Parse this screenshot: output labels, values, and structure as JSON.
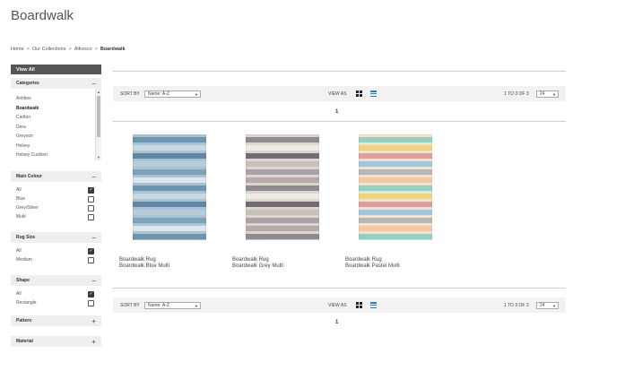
{
  "page": {
    "title": "Boardwalk"
  },
  "breadcrumb": {
    "items": [
      "Home",
      "Our Collections",
      "Alfresco"
    ],
    "current": "Boardwalk",
    "separator": ">"
  },
  "sidebar": {
    "view_all": "View All",
    "categories": {
      "title": "Categories",
      "toggle": "−",
      "items": [
        "Antibes",
        "Boardwalk",
        "Carlton",
        "Dera",
        "Greyson",
        "Helsey",
        "Helsey Cushion"
      ],
      "active": "Boardwalk"
    },
    "main_colour": {
      "title": "Main Colour",
      "toggle": "−",
      "options": [
        {
          "label": "All",
          "checked": true
        },
        {
          "label": "Blue",
          "checked": false
        },
        {
          "label": "Grey/Silver",
          "checked": false
        },
        {
          "label": "Multi",
          "checked": false
        }
      ]
    },
    "rug_size": {
      "title": "Rug Size",
      "toggle": "−",
      "options": [
        {
          "label": "All",
          "checked": true
        },
        {
          "label": "Medium",
          "checked": false
        }
      ]
    },
    "shape": {
      "title": "Shape",
      "toggle": "−",
      "options": [
        {
          "label": "All",
          "checked": true
        },
        {
          "label": "Rectangle",
          "checked": false
        }
      ]
    },
    "pattern": {
      "title": "Pattern",
      "toggle": "+"
    },
    "material": {
      "title": "Material",
      "toggle": "+"
    }
  },
  "toolbar": {
    "sort_label": "SORT BY",
    "sort_value": "Name: A-Z",
    "view_as_label": "VIEW AS",
    "count_text": "1 TO 3 OF 3",
    "per_page": "24",
    "page_number": "1"
  },
  "products": [
    {
      "line1": "Boardwalk Rug",
      "line2": "Boardwalk Blue Multi",
      "base": "#a9c3d0",
      "stripes": [
        "#6d95b0",
        "#c9d9e2",
        "#5f87a5",
        "#b7ccd8",
        "#7ba3bb",
        "#dde6ea"
      ]
    },
    {
      "line1": "Boardwalk Rug",
      "line2": "Boardwalk Grey Multi",
      "base": "#ddd6d0",
      "stripes": [
        "#8f8b8e",
        "#f0ebe6",
        "#6f6d73",
        "#c9c0ba",
        "#a8a3a6",
        "#b9aaa8"
      ]
    },
    {
      "line1": "Boardwalk Rug",
      "line2": "Boardwalk Pastel Multi",
      "base": "#efe4cf",
      "stripes": [
        "#8fd2c6",
        "#f1d37d",
        "#e39b9b",
        "#9ec7e0",
        "#b7b7b7",
        "#f5c8a3"
      ]
    }
  ]
}
